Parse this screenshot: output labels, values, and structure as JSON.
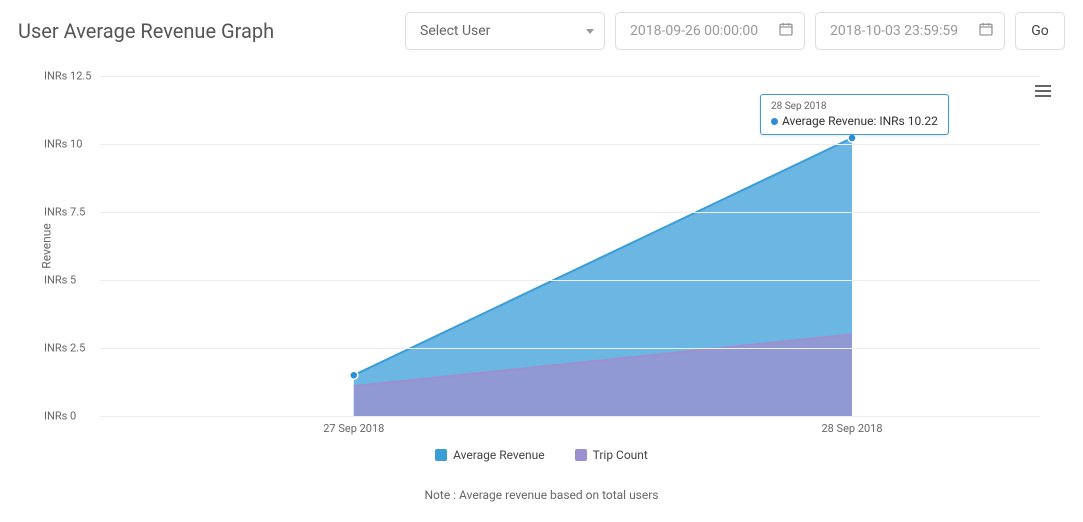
{
  "header": {
    "title": "User Average Revenue Graph",
    "select": {
      "label": "Select User"
    },
    "date_from": {
      "placeholder": "2018-09-26 00:00:00"
    },
    "date_to": {
      "placeholder": "2018-10-03 23:59:59"
    },
    "go_label": "Go"
  },
  "chart": {
    "ylabel": "Revenue",
    "yticks": [
      "INRs 0",
      "INRs 2.5",
      "INRs 5",
      "INRs 7.5",
      "INRs 10",
      "INRs 12.5"
    ],
    "xticks": [
      "27 Sep 2018",
      "28 Sep 2018"
    ],
    "legend": [
      {
        "label": "Average Revenue",
        "color": "#3a9dd8"
      },
      {
        "label": "Trip Count",
        "color": "#9e8fd0"
      }
    ],
    "tooltip": {
      "date": "28 Sep 2018",
      "text": "Average Revenue: INRs 10.22"
    },
    "note": "Note : Average revenue based on total users"
  },
  "chart_data": {
    "type": "area",
    "x": [
      "27 Sep 2018",
      "28 Sep 2018"
    ],
    "series": [
      {
        "name": "Average Revenue",
        "values": [
          1.5,
          10.22
        ],
        "color": "#3a9dd8"
      },
      {
        "name": "Trip Count",
        "values": [
          1.1,
          3.0
        ],
        "color": "#9e8fd0"
      }
    ],
    "ylabel": "Revenue",
    "ylim": [
      0,
      12.5
    ],
    "title": "User Average Revenue Graph"
  }
}
